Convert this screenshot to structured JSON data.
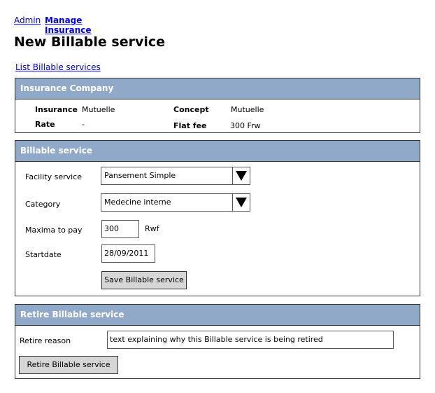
{
  "breadcrumb": {
    "admin": "Admin",
    "manage": "Manage Insurance"
  },
  "page_title": "New Billable service",
  "list_link": "List Billable services",
  "insurance_panel": {
    "title": "Insurance Company",
    "insurance_label": "Insurance",
    "insurance_value": "Mutuelle",
    "rate_label": "Rate",
    "rate_value": "-",
    "concept_label": "Concept",
    "concept_value": "Mutuelle",
    "flatfee_label": "Flat fee",
    "flatfee_value": "300 Frw"
  },
  "billable_panel": {
    "title": "Billable service",
    "facility_label": "Facility service",
    "facility_value": "Pansement Simple",
    "category_label": "Category",
    "category_value": "Medecine interne",
    "maxima_label": "Maxima to pay",
    "maxima_value": "300",
    "maxima_unit": "Rwf",
    "startdate_label": "Startdate",
    "startdate_value": "28/09/2011",
    "save_button": "Save Billable service"
  },
  "retire_panel": {
    "title": "Retire Billable service",
    "reason_label": "Retire reason",
    "reason_value": "text explaining why this Billable service is being retired",
    "retire_button": "Retire Billable service"
  },
  "colors": {
    "panel_header": "#90a9c9",
    "button": "#d6d6d6",
    "link": "#0000ee"
  }
}
